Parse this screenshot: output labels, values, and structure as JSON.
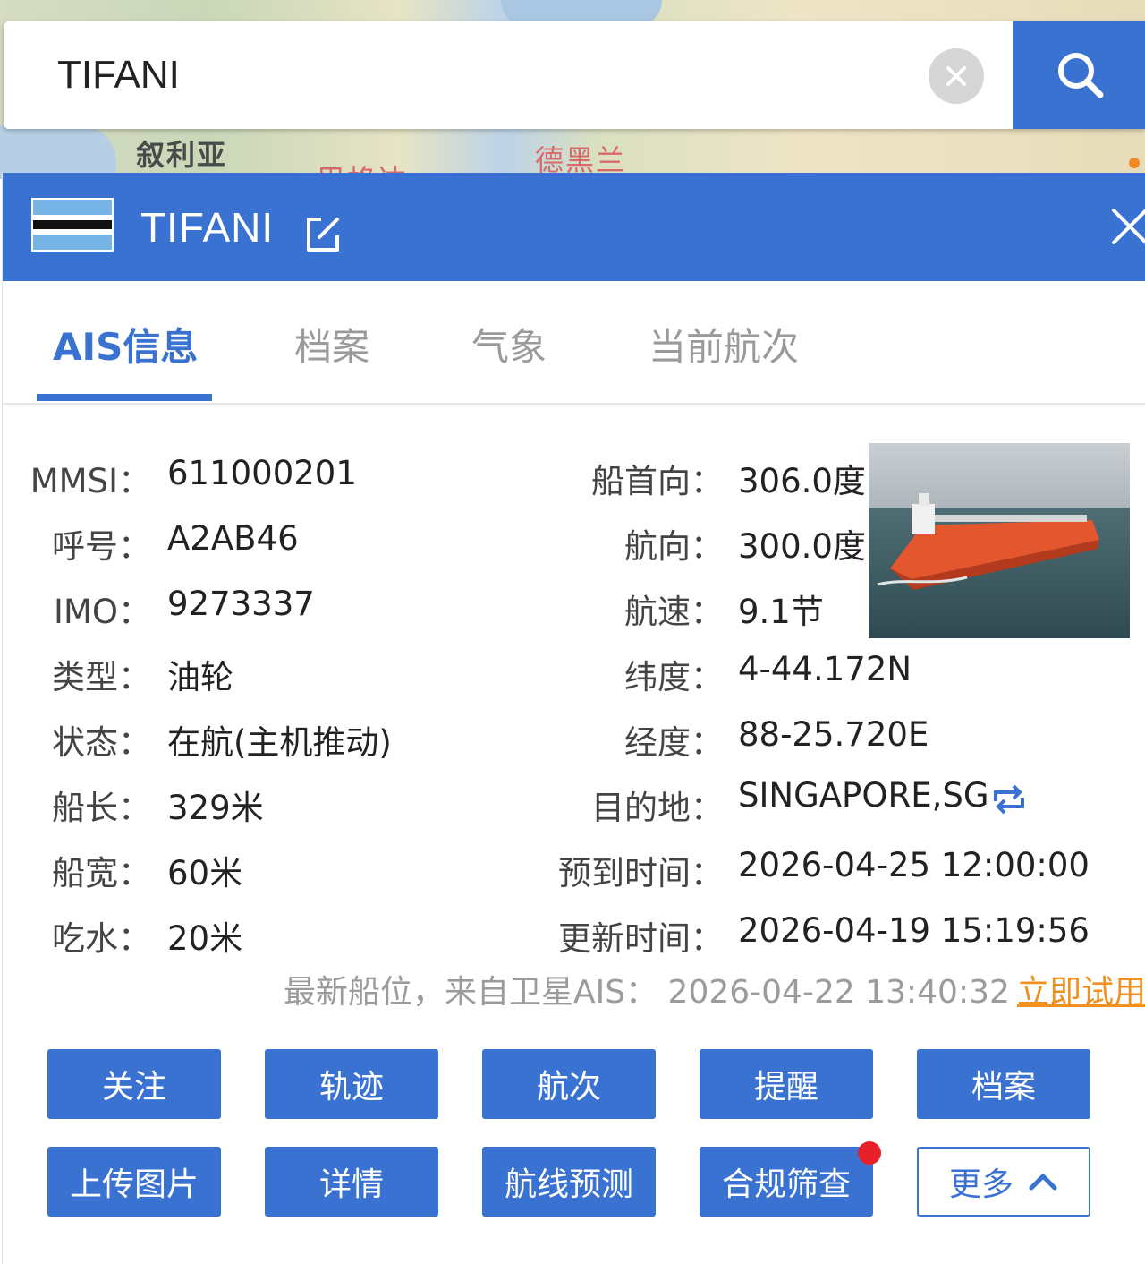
{
  "map": {
    "labels": [
      "叙利亚",
      "巴格达",
      "德黑兰"
    ]
  },
  "search": {
    "value": "TIFANI"
  },
  "header": {
    "ship_name": "TIFANI"
  },
  "tabs": [
    {
      "label": "AIS信息",
      "active": true
    },
    {
      "label": "档案",
      "active": false
    },
    {
      "label": "气象",
      "active": false
    },
    {
      "label": "当前航次",
      "active": false
    }
  ],
  "left_fields": [
    {
      "label": "MMSI：",
      "value": "611000201"
    },
    {
      "label": "呼号：",
      "value": "A2AB46"
    },
    {
      "label": "IMO：",
      "value": "9273337"
    },
    {
      "label": "类型：",
      "value": "油轮"
    },
    {
      "label": "状态：",
      "value": "在航(主机推动)"
    },
    {
      "label": "船长：",
      "value": "329米"
    },
    {
      "label": "船宽：",
      "value": "60米"
    },
    {
      "label": "吃水：",
      "value": "20米"
    }
  ],
  "right_fields": [
    {
      "label": "船首向：",
      "value": "306.0度"
    },
    {
      "label": "航向：",
      "value": "300.0度"
    },
    {
      "label": "航速：",
      "value": "9.1节"
    },
    {
      "label": "纬度：",
      "value": "4-44.172N"
    },
    {
      "label": "经度：",
      "value": "88-25.720E"
    },
    {
      "label": "目的地：",
      "value": "SINGAPORE,SG"
    },
    {
      "label": "预到时间：",
      "value": "2026-04-25 12:00:00"
    },
    {
      "label": "更新时间：",
      "value": "2026-04-19 15:19:56"
    }
  ],
  "satellite": {
    "note": "最新船位，来自卫星AIS： 2026-04-22 13:40:32",
    "try_link": "立即试用"
  },
  "buttons_row1": [
    "关注",
    "轨迹",
    "航次",
    "提醒",
    "档案"
  ],
  "buttons_row2": [
    "上传图片",
    "详情",
    "航线预测",
    "合规筛查",
    "更多"
  ],
  "colors": {
    "primary": "#3a72d1",
    "link": "#f0901e",
    "badge": "#e8202a"
  }
}
